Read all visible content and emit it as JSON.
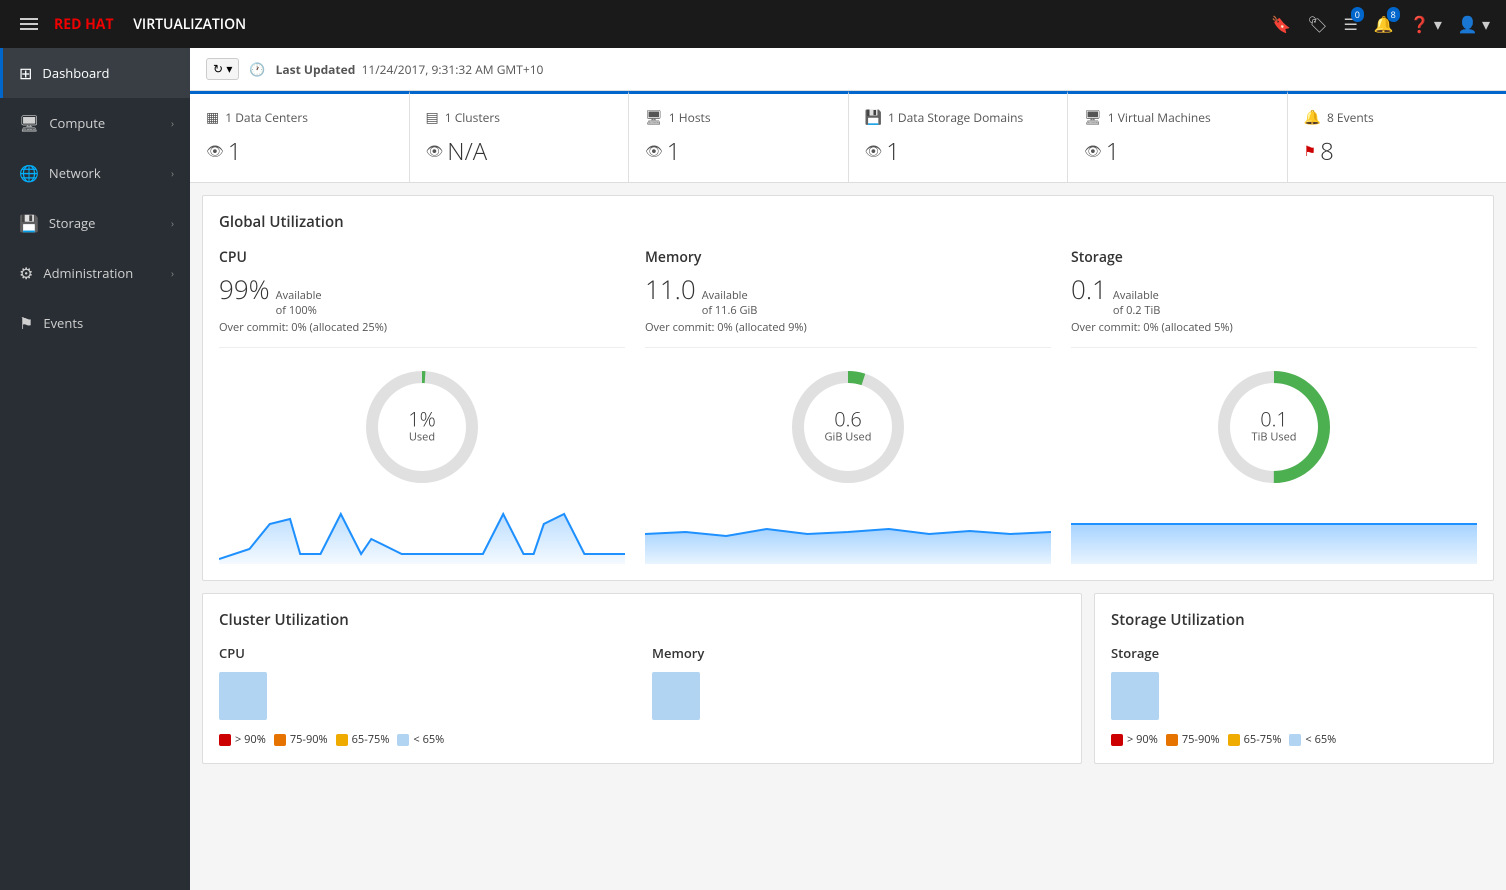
{
  "brand": {
    "prefix": "RED HAT",
    "suffix": "VIRTUALIZATION"
  },
  "topnav": {
    "bookmark_badge": "",
    "tag_badge": "",
    "list_badge": "0",
    "bell_badge": "8",
    "help_label": "?",
    "user_label": "👤"
  },
  "sidebar": {
    "items": [
      {
        "id": "dashboard",
        "label": "Dashboard",
        "icon": "⊞",
        "active": true,
        "hasChevron": false
      },
      {
        "id": "compute",
        "label": "Compute",
        "icon": "🖥",
        "active": false,
        "hasChevron": true
      },
      {
        "id": "network",
        "label": "Network",
        "icon": "🌐",
        "active": false,
        "hasChevron": true
      },
      {
        "id": "storage",
        "label": "Storage",
        "icon": "💾",
        "active": false,
        "hasChevron": true
      },
      {
        "id": "administration",
        "label": "Administration",
        "icon": "⚙",
        "active": false,
        "hasChevron": true
      },
      {
        "id": "events",
        "label": "Events",
        "icon": "⚑",
        "active": false,
        "hasChevron": false
      }
    ]
  },
  "header": {
    "last_updated_label": "Last Updated",
    "last_updated_value": "11/24/2017, 9:31:32 AM GMT+10"
  },
  "summary_cards": [
    {
      "id": "data-centers",
      "icon": "▦",
      "count_label": "1",
      "title": "Data Centers",
      "sub_count": "1",
      "sub_icon": "eye"
    },
    {
      "id": "clusters",
      "icon": "▤",
      "count_label": "1",
      "title": "Clusters",
      "sub_count": "N/A",
      "sub_icon": "eye"
    },
    {
      "id": "hosts",
      "icon": "🖥",
      "count_label": "1",
      "title": "Hosts",
      "sub_count": "1",
      "sub_icon": "eye"
    },
    {
      "id": "data-storage",
      "icon": "💾",
      "count_label": "1",
      "title": "Data Storage Domains",
      "sub_count": "1",
      "sub_icon": "eye"
    },
    {
      "id": "virtual-machines",
      "icon": "🖥",
      "count_label": "1",
      "title": "Virtual Machines",
      "sub_count": "1",
      "sub_icon": "eye"
    },
    {
      "id": "events",
      "icon": "🔔",
      "count_label": "8",
      "title": "Events",
      "sub_count": "8",
      "sub_icon": "flag"
    }
  ],
  "global_util": {
    "title": "Global Utilization",
    "cpu": {
      "title": "CPU",
      "available_value": "99%",
      "available_label": "Available",
      "available_of": "of 100%",
      "overcommit": "Over commit: 0% (allocated 25%)",
      "donut_value": "1%",
      "donut_label": "Used",
      "used_pct": 1
    },
    "memory": {
      "title": "Memory",
      "available_value": "11.0",
      "available_label": "Available",
      "available_of": "of 11.6 GiB",
      "overcommit": "Over commit: 0% (allocated 9%)",
      "donut_value": "0.6",
      "donut_label": "GiB Used",
      "used_pct": 5
    },
    "storage": {
      "title": "Storage",
      "available_value": "0.1",
      "available_label": "Available",
      "available_of": "of 0.2 TiB",
      "overcommit": "Over commit: 0% (allocated 5%)",
      "donut_value": "0.1",
      "donut_label": "TiB Used",
      "used_pct": 50
    }
  },
  "cluster_util": {
    "title": "Cluster Utilization",
    "cpu_label": "CPU",
    "memory_label": "Memory",
    "legend": [
      {
        "color": "red",
        "label": "> 90%"
      },
      {
        "color": "orange",
        "label": "75-90%"
      },
      {
        "color": "yellow",
        "label": "65-75%"
      },
      {
        "color": "blue",
        "label": "< 65%"
      }
    ]
  },
  "storage_util": {
    "title": "Storage Utilization",
    "storage_label": "Storage",
    "legend": [
      {
        "color": "red",
        "label": "> 90%"
      },
      {
        "color": "orange",
        "label": "75-90%"
      },
      {
        "color": "yellow",
        "label": "65-75%"
      },
      {
        "color": "blue",
        "label": "< 65%"
      }
    ]
  }
}
